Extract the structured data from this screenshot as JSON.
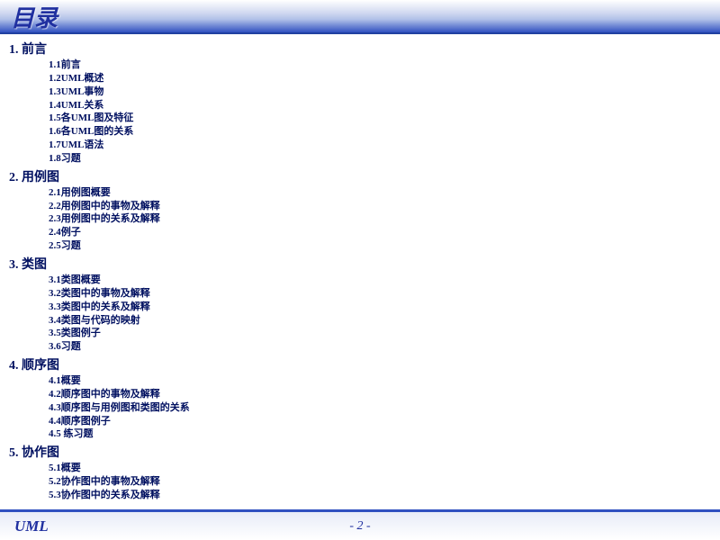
{
  "header": {
    "title": "目录"
  },
  "toc": [
    {
      "label": "1. 前言",
      "items": [
        "1.1前言",
        "1.2UML概述",
        "1.3UML事物",
        "1.4UML关系",
        "1.5各UML图及特征",
        "1.6各UML图的关系",
        "1.7UML语法",
        "1.8习题"
      ]
    },
    {
      "label": "2.  用例图",
      "items": [
        "2.1用例图概要",
        "2.2用例图中的事物及解释",
        "2.3用例图中的关系及解释",
        "2.4例子",
        "2.5习题"
      ]
    },
    {
      "label": "3.  类图",
      "items": [
        "3.1类图概要",
        "3.2类图中的事物及解释",
        "3.3类图中的关系及解释",
        "3.4类图与代码的映射",
        "3.5类图例子",
        "3.6习题"
      ]
    },
    {
      "label": "4.  顺序图",
      "items": [
        "4.1概要",
        "4.2顺序图中的事物及解释",
        "4.3顺序图与用例图和类图的关系",
        "4.4顺序图例子",
        "4.5 练习题"
      ]
    },
    {
      "label": "5. 协作图",
      "items": [
        "5.1概要",
        "5.2协作图中的事物及解释",
        "5.3协作图中的关系及解释"
      ]
    }
  ],
  "footer": {
    "left": "UML",
    "page": "- 2 -"
  }
}
